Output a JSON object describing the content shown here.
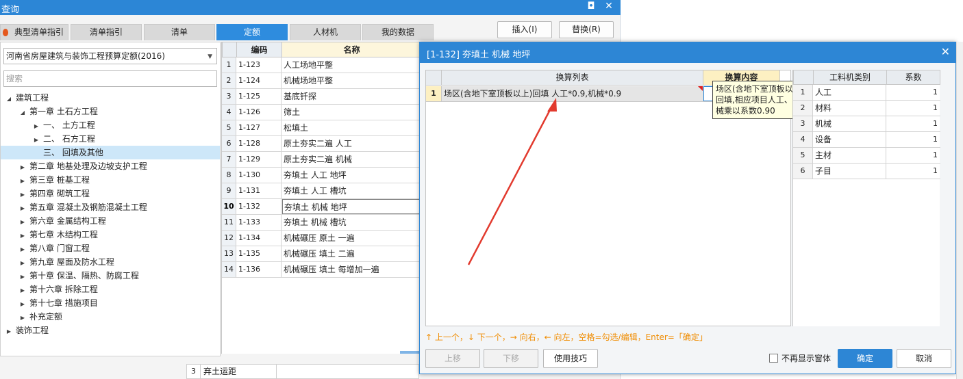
{
  "query_window": {
    "title": "查询",
    "restore_glyph": "◘",
    "close_glyph": "✕",
    "tabs": [
      {
        "label": "典型清单指引",
        "active": false
      },
      {
        "label": "清单指引",
        "active": false
      },
      {
        "label": "清单",
        "active": false
      },
      {
        "label": "定额",
        "active": true
      },
      {
        "label": "人材机",
        "active": false
      },
      {
        "label": "我的数据",
        "active": false
      }
    ],
    "insert_label": "插入(I)",
    "replace_label": "替换(R)",
    "dataset_select": "河南省房屋建筑与装饰工程预算定额(2016)",
    "search_placeholder": "搜索",
    "tree": [
      {
        "label": "建筑工程",
        "level": 0,
        "expanded": true
      },
      {
        "label": "第一章 土石方工程",
        "level": 1,
        "expanded": true
      },
      {
        "label": "一、 土方工程",
        "level": 2,
        "expanded": false
      },
      {
        "label": "二、 石方工程",
        "level": 2,
        "expanded": false
      },
      {
        "label": "三、 回填及其他",
        "level": 2,
        "expanded": null,
        "selected": true
      },
      {
        "label": "第二章 地基处理及边坡支护工程",
        "level": 1,
        "expanded": false
      },
      {
        "label": "第三章 桩基工程",
        "level": 1,
        "expanded": false
      },
      {
        "label": "第四章 砌筑工程",
        "level": 1,
        "expanded": false
      },
      {
        "label": "第五章 混凝土及钢筋混凝土工程",
        "level": 1,
        "expanded": false
      },
      {
        "label": "第六章 金属结构工程",
        "level": 1,
        "expanded": false
      },
      {
        "label": "第七章 木结构工程",
        "level": 1,
        "expanded": false
      },
      {
        "label": "第八章 门窗工程",
        "level": 1,
        "expanded": false
      },
      {
        "label": "第九章 屋面及防水工程",
        "level": 1,
        "expanded": false
      },
      {
        "label": "第十章 保温、隔热、防腐工程",
        "level": 1,
        "expanded": false
      },
      {
        "label": "第十六章 拆除工程",
        "level": 1,
        "expanded": false
      },
      {
        "label": "第十七章 措施项目",
        "level": 1,
        "expanded": false
      },
      {
        "label": "补充定额",
        "level": 1,
        "expanded": false
      },
      {
        "label": "装饰工程",
        "level": 0,
        "expanded": false
      }
    ],
    "code_table": {
      "headers": {
        "code": "编码",
        "name": "名称"
      },
      "rows": [
        {
          "no": "1",
          "code": "1-123",
          "name": "人工场地平整"
        },
        {
          "no": "2",
          "code": "1-124",
          "name": "机械场地平整"
        },
        {
          "no": "3",
          "code": "1-125",
          "name": "基底钎探"
        },
        {
          "no": "4",
          "code": "1-126",
          "name": "筛土"
        },
        {
          "no": "5",
          "code": "1-127",
          "name": "松填土"
        },
        {
          "no": "6",
          "code": "1-128",
          "name": "原土夯实二遍 人工"
        },
        {
          "no": "7",
          "code": "1-129",
          "name": "原土夯实二遍 机械"
        },
        {
          "no": "8",
          "code": "1-130",
          "name": "夯填土 人工 地坪"
        },
        {
          "no": "9",
          "code": "1-131",
          "name": "夯填土 人工 槽坑"
        },
        {
          "no": "10",
          "code": "1-132",
          "name": "夯填土 机械 地坪",
          "current": true
        },
        {
          "no": "11",
          "code": "1-133",
          "name": "夯填土 机械 槽坑"
        },
        {
          "no": "12",
          "code": "1-134",
          "name": "机械碾压 原土 一遍"
        },
        {
          "no": "13",
          "code": "1-135",
          "name": "机械碾压 填土 二遍"
        },
        {
          "no": "14",
          "code": "1-136",
          "name": "机械碾压 填土 每增加一遍"
        }
      ]
    },
    "bottom_row": {
      "no": "3",
      "text": "弃土运距"
    }
  },
  "dialog": {
    "title": "[1-132] 夯填土 机械 地坪",
    "close_glyph": "✕",
    "conversion_headers": {
      "list": "换算列表",
      "content": "换算内容"
    },
    "conversion_row": {
      "no": "1",
      "text": "场区(含地下室顶板以上)回填 人工*0.9,机械*0.9"
    },
    "tooltip": "场区(含地下室顶板以上)回填,相应项目人工、机械乘以系数0.90",
    "category_headers": {
      "type": "工料机类别",
      "coef": "系数"
    },
    "category_rows": [
      {
        "no": "1",
        "type": "人工",
        "coef": "1"
      },
      {
        "no": "2",
        "type": "材料",
        "coef": "1"
      },
      {
        "no": "3",
        "type": "机械",
        "coef": "1"
      },
      {
        "no": "4",
        "type": "设备",
        "coef": "1"
      },
      {
        "no": "5",
        "type": "主材",
        "coef": "1"
      },
      {
        "no": "6",
        "type": "子目",
        "coef": "1"
      }
    ],
    "hint": "↑ 上一个，↓ 下一个，→ 向右，← 向左，空格=勾选/编辑，Enter=「确定」",
    "move_up_label": "上移",
    "move_down_label": "下移",
    "tips_label": "使用技巧",
    "no_show_label": "不再显示窗体",
    "ok_label": "确定",
    "cancel_label": "取消",
    "accent_color": "#2d86d5",
    "hint_color": "#f08c00"
  }
}
